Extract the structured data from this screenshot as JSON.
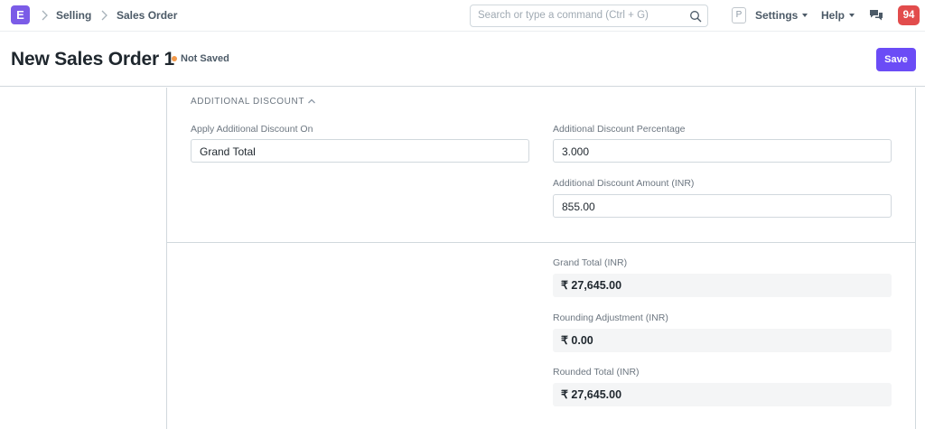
{
  "navbar": {
    "logo_letter": "E",
    "breadcrumbs": [
      "Selling",
      "Sales Order"
    ],
    "search_placeholder": "Search or type a command (Ctrl + G)",
    "user_initial": "P",
    "settings_label": "Settings",
    "help_label": "Help",
    "notification_count": "94"
  },
  "page": {
    "title": "New Sales Order 1",
    "status": "Not Saved",
    "save_label": "Save"
  },
  "section": {
    "heading": "ADDITIONAL DISCOUNT"
  },
  "fields": {
    "apply_discount_on": {
      "label": "Apply Additional Discount On",
      "value": "Grand Total"
    },
    "discount_percentage": {
      "label": "Additional Discount Percentage",
      "value": "3.000"
    },
    "discount_amount": {
      "label": "Additional Discount Amount (INR)",
      "value": "855.00"
    },
    "grand_total": {
      "label": "Grand Total (INR)",
      "value": "₹ 27,645.00"
    },
    "rounding_adjustment": {
      "label": "Rounding Adjustment (INR)",
      "value": "₹ 0.00"
    },
    "rounded_total": {
      "label": "Rounded Total (INR)",
      "value": "₹ 27,645.00"
    }
  },
  "colors": {
    "accent": "#6b4cf6",
    "badge": "#e24c4c",
    "status_dot": "#f2994a"
  }
}
